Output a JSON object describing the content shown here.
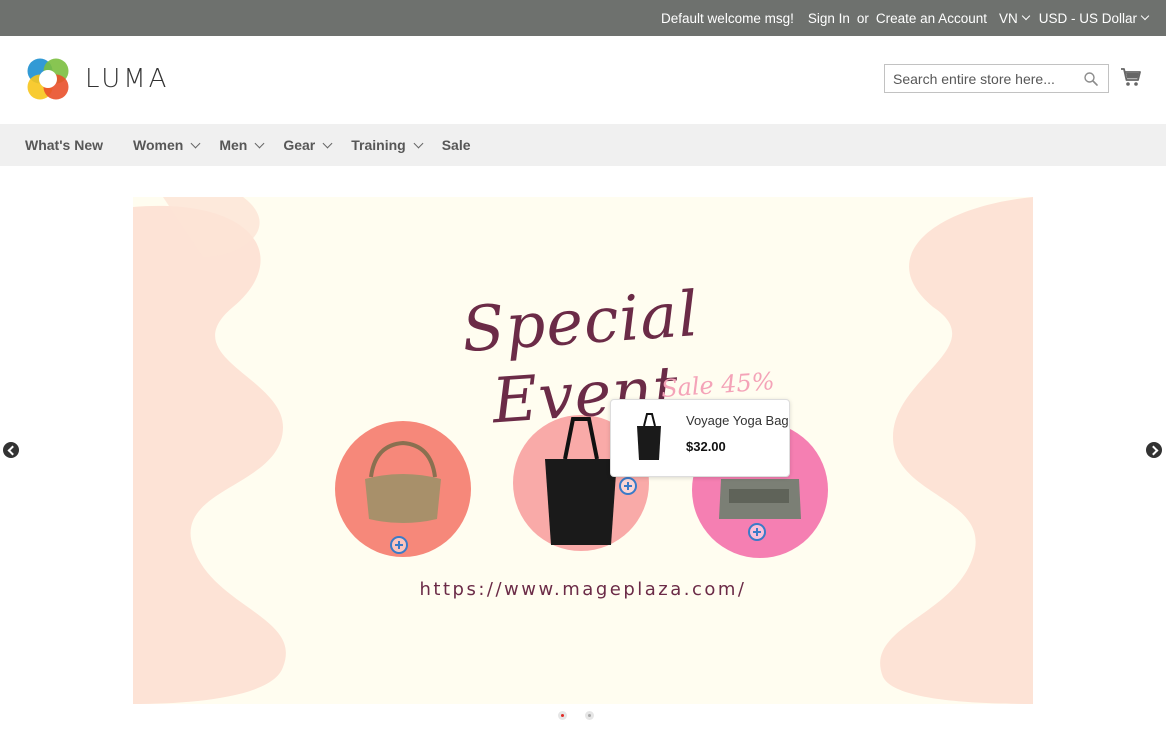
{
  "topbar": {
    "welcome": "Default welcome msg!",
    "sign_in": "Sign In",
    "or": "or",
    "create_account": "Create an Account",
    "language": "VN",
    "currency": "USD - US Dollar"
  },
  "header": {
    "logo_text": "LUMA",
    "search_placeholder": "Search entire store here...",
    "cart_icon": "cart-icon",
    "search_icon": "search-icon"
  },
  "nav": {
    "items": [
      {
        "label": "What's New",
        "dropdown": false
      },
      {
        "label": "Women",
        "dropdown": true
      },
      {
        "label": "Men",
        "dropdown": true
      },
      {
        "label": "Gear",
        "dropdown": true
      },
      {
        "label": "Training",
        "dropdown": true
      },
      {
        "label": "Sale",
        "dropdown": false
      }
    ]
  },
  "banner": {
    "title": "Special Event",
    "sale": "Sale 45%",
    "url": "https://www.mageplaza.com/",
    "colors": {
      "background": "#fffdf0",
      "brush": "#fde3d6",
      "circle_left": "#f6887a",
      "circle_mid": "#f9aaa8",
      "circle_right": "#f57fb2",
      "title": "#6b2b47"
    },
    "tooltip": {
      "name": "Voyage Yoga Bag",
      "price": "$32.00"
    },
    "slides": {
      "current": 1,
      "total": 2
    }
  }
}
